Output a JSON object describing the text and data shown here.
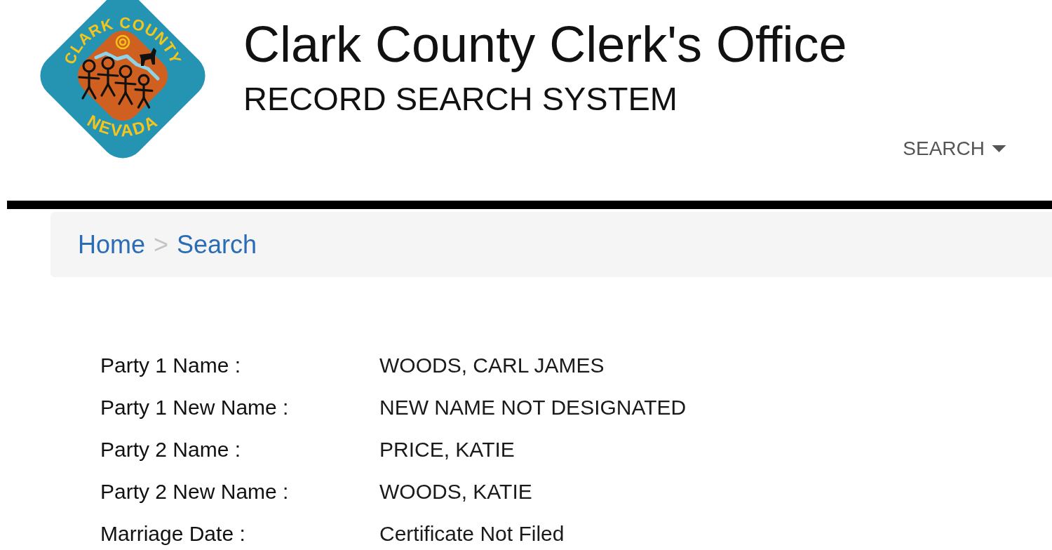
{
  "header": {
    "logo": {
      "top_text": "CLARK COUNTY",
      "bottom_text": "NEVADA"
    },
    "title": "Clark County Clerk's Office",
    "subtitle": "RECORD SEARCH SYSTEM"
  },
  "nav": {
    "items": [
      {
        "label": "SEARCH"
      }
    ]
  },
  "breadcrumb": [
    {
      "kind": "link",
      "label": "Home"
    },
    {
      "kind": "separator",
      "label": ">"
    },
    {
      "kind": "link",
      "label": "Search"
    }
  ],
  "record": {
    "rows": [
      {
        "label": "Party 1 Name :",
        "value": "WOODS, CARL JAMES"
      },
      {
        "label": "Party 1 New Name :",
        "value": "NEW NAME NOT DESIGNATED"
      },
      {
        "label": "Party 2 Name :",
        "value": "PRICE, KATIE"
      },
      {
        "label": "Party 2 New Name :",
        "value": "WOODS, KATIE"
      },
      {
        "label": "Marriage Date :",
        "value": "Certificate Not Filed"
      }
    ]
  }
}
